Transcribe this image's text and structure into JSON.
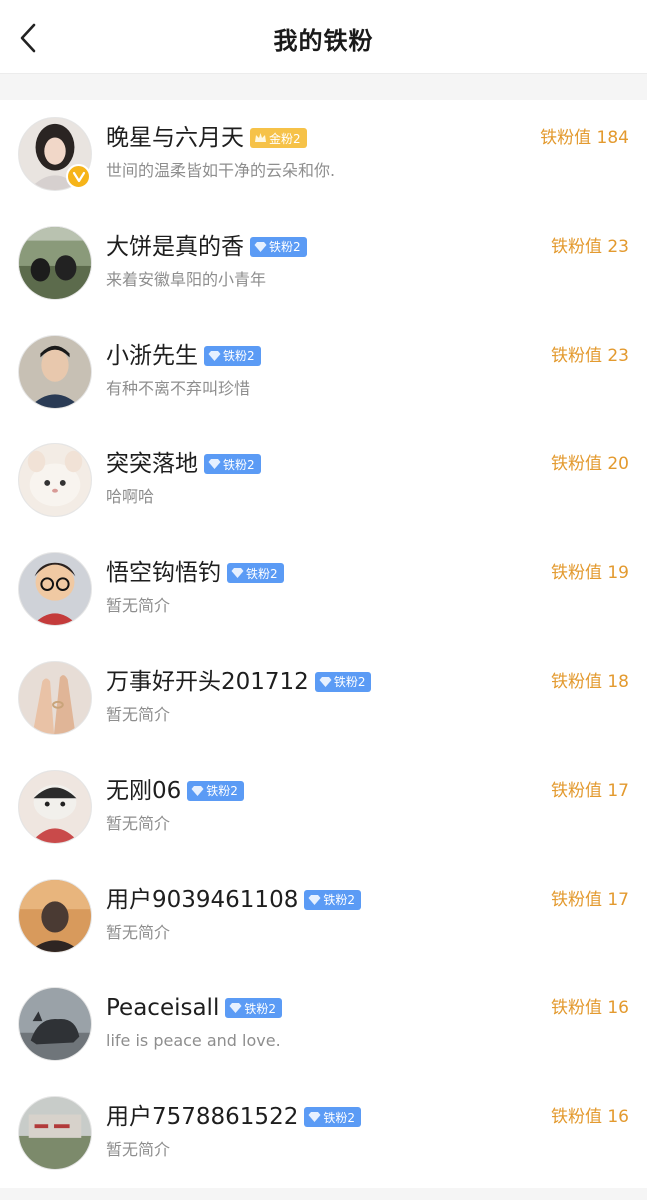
{
  "header": {
    "title": "我的铁粉"
  },
  "colors": {
    "accent_score": "#e39a2f",
    "badge_iron": "#5b9bf5",
    "badge_gold": "#f6c248",
    "verified": "#f6b419"
  },
  "fans": [
    {
      "name": "晚星与六月天",
      "badge": "金粉2",
      "badge_type": "gold",
      "bio": "世间的温柔皆如干净的云朵和你.",
      "score": "铁粉值 184",
      "verified": true
    },
    {
      "name": "大饼是真的香",
      "badge": "铁粉2",
      "badge_type": "iron",
      "bio": "来着安徽阜阳的小青年",
      "score": "铁粉值 23"
    },
    {
      "name": "小浙先生",
      "badge": "铁粉2",
      "badge_type": "iron",
      "bio": "有种不离不弃叫珍惜",
      "score": "铁粉值 23"
    },
    {
      "name": "突突落地",
      "badge": "铁粉2",
      "badge_type": "iron",
      "bio": "哈啊哈",
      "score": "铁粉值 20"
    },
    {
      "name": "悟空钩悟钓",
      "badge": "铁粉2",
      "badge_type": "iron",
      "bio": "暂无简介",
      "score": "铁粉值 19"
    },
    {
      "name": "万事好开头201712",
      "badge": "铁粉2",
      "badge_type": "iron",
      "bio": "暂无简介",
      "score": "铁粉值 18"
    },
    {
      "name": "无刚06",
      "badge": "铁粉2",
      "badge_type": "iron",
      "bio": "暂无简介",
      "score": "铁粉值 17"
    },
    {
      "name": "用户9039461108",
      "badge": "铁粉2",
      "badge_type": "iron",
      "bio": "暂无简介",
      "score": "铁粉值 17"
    },
    {
      "name": "Peaceisall",
      "badge": "铁粉2",
      "badge_type": "iron",
      "bio": "life is peace and love.",
      "score": "铁粉值 16"
    },
    {
      "name": "用户7578861522",
      "badge": "铁粉2",
      "badge_type": "iron",
      "bio": "暂无简介",
      "score": "铁粉值 16"
    }
  ]
}
